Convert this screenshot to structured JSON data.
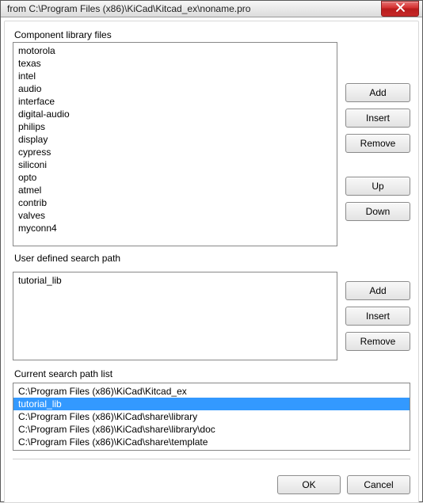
{
  "window": {
    "title": "from C:\\Program Files (x86)\\KiCad\\Kitcad_ex\\noname.pro"
  },
  "componentLib": {
    "label": "Component library files",
    "items": [
      "motorola",
      "texas",
      "intel",
      "audio",
      "interface",
      "digital-audio",
      "philips",
      "display",
      "cypress",
      "siliconi",
      "opto",
      "atmel",
      "contrib",
      "valves",
      "myconn4"
    ],
    "buttons": {
      "add": "Add",
      "insert": "Insert",
      "remove": "Remove",
      "up": "Up",
      "down": "Down"
    }
  },
  "userPath": {
    "label": "User defined search path",
    "items": [
      "tutorial_lib"
    ],
    "buttons": {
      "add": "Add",
      "insert": "Insert",
      "remove": "Remove"
    }
  },
  "searchPathList": {
    "label": "Current search path list",
    "items": [
      "C:\\Program Files (x86)\\KiCad\\Kitcad_ex",
      "tutorial_lib",
      "C:\\Program Files (x86)\\KiCad\\share\\library",
      "C:\\Program Files (x86)\\KiCad\\share\\library\\doc",
      "C:\\Program Files (x86)\\KiCad\\share\\template"
    ],
    "selectedIndex": 1
  },
  "dialogButtons": {
    "ok": "OK",
    "cancel": "Cancel"
  }
}
